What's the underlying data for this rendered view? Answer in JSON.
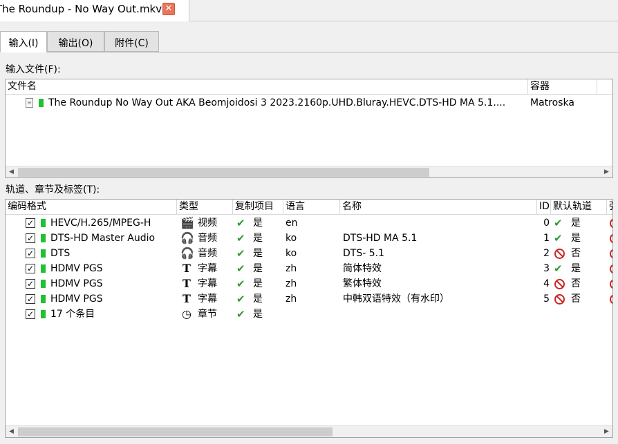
{
  "doc_tab": {
    "title": "The Roundup - No Way Out.mkv",
    "close": "✕"
  },
  "tabs": [
    {
      "label": "输入(I)"
    },
    {
      "label": "输出(O)"
    },
    {
      "label": "附件(C)"
    }
  ],
  "input_files": {
    "label": "输入文件(F):",
    "columns": {
      "file_name": "文件名",
      "container": "容器"
    },
    "rows": [
      {
        "file_name": "The Roundup No Way Out AKA Beomjoidosi 3 2023.2160p.UHD.Bluray.HEVC.DTS-HD MA 5.1....",
        "container": "Matroska"
      }
    ]
  },
  "tracks": {
    "label": "轨道、章节及标签(T):",
    "columns": {
      "codec": "编码格式",
      "type": "类型",
      "copy": "复制项目",
      "language": "语言",
      "name": "名称",
      "id": "ID",
      "default": "默认轨道",
      "forced": "强"
    },
    "rows": [
      {
        "checked": "✓",
        "codec": "HEVC/H.265/MPEG-H",
        "type_icon": "video-icon",
        "type": "视频",
        "copy": "是",
        "language": "en",
        "name": "",
        "id": "0",
        "default_icon": "check-icon",
        "default": "是"
      },
      {
        "checked": "✓",
        "codec": "DTS-HD Master Audio",
        "type_icon": "headphones-icon",
        "type": "音频",
        "copy": "是",
        "language": "ko",
        "name": "DTS-HD MA 5.1",
        "id": "1",
        "default_icon": "check-icon",
        "default": "是"
      },
      {
        "checked": "✓",
        "codec": "DTS",
        "type_icon": "headphones-icon",
        "type": "音频",
        "copy": "是",
        "language": "ko",
        "name": "DTS- 5.1",
        "id": "2",
        "default_icon": "no-icon",
        "default": "否"
      },
      {
        "checked": "✓",
        "codec": "HDMV PGS",
        "type_icon": "text-icon",
        "type": "字幕",
        "copy": "是",
        "language": "zh",
        "name": "简体特效",
        "id": "3",
        "default_icon": "check-icon",
        "default": "是"
      },
      {
        "checked": "✓",
        "codec": "HDMV PGS",
        "type_icon": "text-icon",
        "type": "字幕",
        "copy": "是",
        "language": "zh",
        "name": "繁体特效",
        "id": "4",
        "default_icon": "no-icon",
        "default": "否"
      },
      {
        "checked": "✓",
        "codec": "HDMV PGS",
        "type_icon": "text-icon",
        "type": "字幕",
        "copy": "是",
        "language": "zh",
        "name": "中韩双语特效（有水印）",
        "id": "5",
        "default_icon": "no-icon",
        "default": "否"
      },
      {
        "checked": "✓",
        "codec": "17 个条目",
        "type_icon": "clock-icon",
        "type": "章节",
        "copy": "是",
        "language": "",
        "name": "",
        "id": "",
        "default_icon": "",
        "default": ""
      }
    ]
  },
  "colors": {
    "green_marker": "#22c033",
    "ok_green": "#2e9a2e",
    "no_red": "#cc2222"
  }
}
